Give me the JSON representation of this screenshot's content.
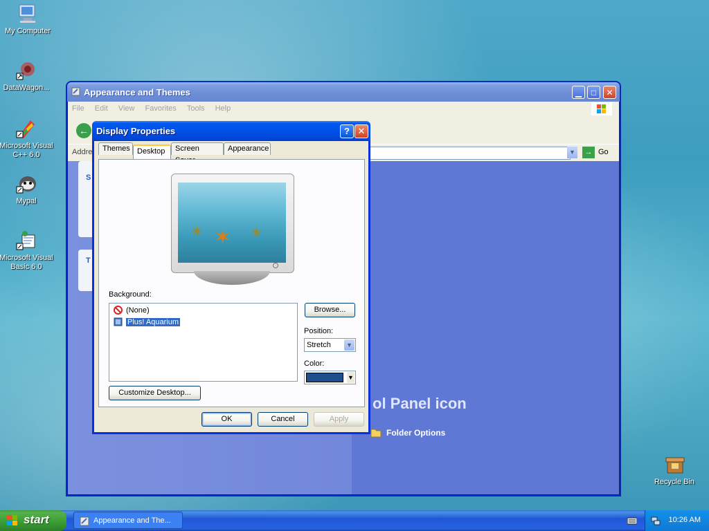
{
  "desktop": {
    "icons": [
      {
        "label": "My Computer"
      },
      {
        "label": "DataWagon..."
      },
      {
        "label": "Microsoft Visual C++ 6.0"
      },
      {
        "label": "Mypal"
      },
      {
        "label": "Microsoft Visual Basic 6.0"
      },
      {
        "label": "Recycle Bin"
      }
    ]
  },
  "main_window": {
    "title": "Appearance and Themes",
    "menu": [
      "File",
      "Edit",
      "View",
      "Favorites",
      "Tools",
      "Help"
    ],
    "address_label": "Addre",
    "go_label": "Go",
    "heading": "ol Panel icon",
    "folder_options": "Folder Options",
    "side_letters": [
      "S",
      "T"
    ]
  },
  "dialog": {
    "title": "Display Properties",
    "help_glyph": "?",
    "close_glyph": "✕",
    "tabs": [
      "Themes",
      "Desktop",
      "Screen Saver",
      "Appearance"
    ],
    "active_tab": "Desktop",
    "background_label": "Background:",
    "background_items": [
      {
        "label": "(None)",
        "selected": false
      },
      {
        "label": "Plus! Aquarium",
        "selected": true
      }
    ],
    "browse_label": "Browse...",
    "position_label": "Position:",
    "position_value": "Stretch",
    "color_label": "Color:",
    "color_value": "#1f4e8c",
    "customize_label": "Customize Desktop...",
    "ok_label": "OK",
    "cancel_label": "Cancel",
    "apply_label": "Apply"
  },
  "taskbar": {
    "start_label": "start",
    "task_label": "Appearance and The...",
    "clock": "10:26 AM"
  },
  "colors": {
    "xp_blue": "#0054e3",
    "start_green": "#3a9b33"
  }
}
